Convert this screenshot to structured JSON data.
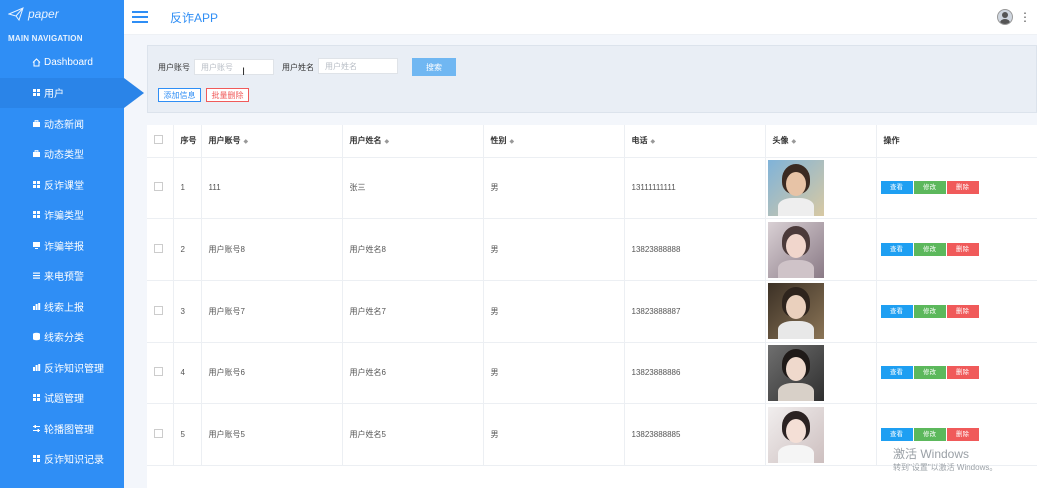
{
  "sidebar": {
    "brand": "paper",
    "nav_header": "MAIN NAVIGATION",
    "items": [
      {
        "label": "Dashboard",
        "icon": "home-icon"
      },
      {
        "label": "用户",
        "icon": "grid-icon"
      },
      {
        "label": "动态新闻",
        "icon": "briefcase-icon"
      },
      {
        "label": "动态类型",
        "icon": "briefcase-icon"
      },
      {
        "label": "反诈课堂",
        "icon": "grid-icon"
      },
      {
        "label": "诈骗类型",
        "icon": "grid-icon"
      },
      {
        "label": "诈骗举报",
        "icon": "monitor-icon"
      },
      {
        "label": "来电预警",
        "icon": "list-icon"
      },
      {
        "label": "线索上报",
        "icon": "bar-icon"
      },
      {
        "label": "线索分类",
        "icon": "database-icon"
      },
      {
        "label": "反诈知识管理",
        "icon": "bar-icon"
      },
      {
        "label": "试题管理",
        "icon": "grid-icon"
      },
      {
        "label": "轮播图管理",
        "icon": "sliders-icon"
      },
      {
        "label": "反诈知识记录",
        "icon": "grid-icon"
      }
    ]
  },
  "topbar": {
    "title": "反诈APP"
  },
  "search": {
    "account_label": "用户账号",
    "account_placeholder": "用户账号",
    "name_label": "用户姓名",
    "name_placeholder": "用户姓名",
    "search_button": "搜索",
    "add_button": "添加信息",
    "batch_delete_button": "批量删除"
  },
  "table": {
    "headers": [
      "序号",
      "用户账号",
      "用户姓名",
      "性别",
      "电话",
      "头像",
      "操作"
    ],
    "rows": [
      {
        "index": "1",
        "account": "111",
        "name": "张三",
        "gender": "男",
        "phone": "13111111111"
      },
      {
        "index": "2",
        "account": "用户账号8",
        "name": "用户姓名8",
        "gender": "男",
        "phone": "13823888888"
      },
      {
        "index": "3",
        "account": "用户账号7",
        "name": "用户姓名7",
        "gender": "男",
        "phone": "13823888887"
      },
      {
        "index": "4",
        "account": "用户账号6",
        "name": "用户姓名6",
        "gender": "男",
        "phone": "13823888886"
      },
      {
        "index": "5",
        "account": "用户账号5",
        "name": "用户姓名5",
        "gender": "男",
        "phone": "13823888885"
      }
    ],
    "actions": {
      "view": "查看",
      "edit": "修改",
      "delete": "删除"
    }
  },
  "watermark": {
    "line1": "激活 Windows",
    "line2": "转到\"设置\"以激活 Windows。"
  },
  "colors": {
    "sidebar": "#2f8ef5",
    "accent": "#2f8ef5",
    "view": "#1e9ff2",
    "edit": "#5cb85c",
    "delete": "#f05a5a"
  }
}
